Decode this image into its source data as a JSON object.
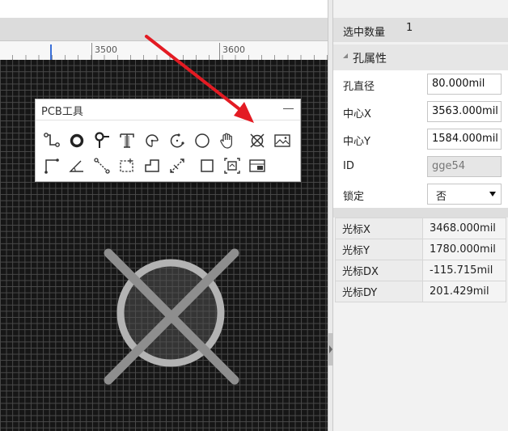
{
  "ruler": {
    "labels": [
      "3500",
      "3600"
    ]
  },
  "toolbar": {
    "title": "PCB工具",
    "row1": [
      "track-icon",
      "pad-icon",
      "via-icon",
      "text-icon",
      "arc-center-icon",
      "arc-end-icon",
      "circle-icon",
      "pan-hand-icon",
      "hole-icon",
      "image-icon"
    ],
    "row2": [
      "dimension-icon",
      "angle-icon",
      "connect-icon",
      "rect-select-icon",
      "polygon-icon",
      "measure-icon",
      "rectangle-icon",
      "copper-area-icon",
      "board-outline-icon"
    ]
  },
  "right_panel": {
    "selected_label": "选中数量",
    "selected_count": "1",
    "section_title": "孔属性",
    "properties": [
      {
        "key": "diameter",
        "label": "孔直径",
        "value": "80.000mil"
      },
      {
        "key": "cx",
        "label": "中心X",
        "value": "3563.000mil"
      },
      {
        "key": "cy",
        "label": "中心Y",
        "value": "1584.000mil"
      },
      {
        "key": "id",
        "label": "ID",
        "value": "gge54"
      },
      {
        "key": "lock",
        "label": "锁定",
        "value": "否"
      }
    ],
    "cursor": [
      {
        "label": "光标X",
        "value": "3468.000mil"
      },
      {
        "label": "光标Y",
        "value": "1780.000mil"
      },
      {
        "label": "光标DX",
        "value": "-115.715mil"
      },
      {
        "label": "光标DY",
        "value": "201.429mil"
      }
    ]
  },
  "colors": {
    "canvas_bg": "#161616",
    "grid": "#4a4a4a",
    "hole_stroke": "#b3b3b3",
    "annotation_arrow": "#e31b23"
  }
}
